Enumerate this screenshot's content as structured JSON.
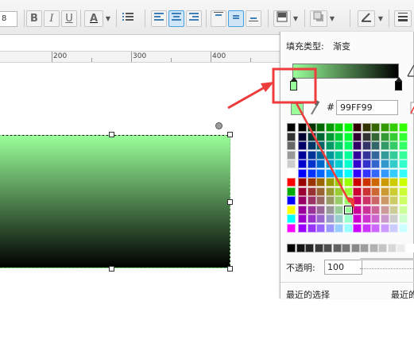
{
  "toolbar": {
    "font_size_value": "8",
    "bold_label": "B",
    "italic_label": "I",
    "underline_label": "U",
    "font_color_label": "A",
    "list_icon": "bullet-list-icon",
    "align_icons": [
      "align-left-icon",
      "align-center-icon",
      "align-right-icon"
    ],
    "valign_icons": [
      "valign-top-icon",
      "valign-middle-icon",
      "valign-bottom-icon"
    ],
    "fill_icon": "fill-color-icon",
    "shadow_icon": "shadow-icon",
    "line_color_icon": "pen-icon",
    "line_style_icon": "line-style-icon"
  },
  "ruler": {
    "labels": [
      "200",
      "300",
      "400"
    ]
  },
  "panel": {
    "fill_type_label": "填充类型:",
    "fill_type_value": "渐变",
    "hash_label": "#",
    "hex_value": "99FF99",
    "opacity_label": "不透明:",
    "opacity_value": "100",
    "recent_label": "最近的选择",
    "recent_label_2": "最近的"
  },
  "colors": {
    "gradient_start": "#99ff99",
    "gradient_end": "#000000",
    "annotation": "#ee3b3b",
    "accent": "#3d7fb8"
  }
}
